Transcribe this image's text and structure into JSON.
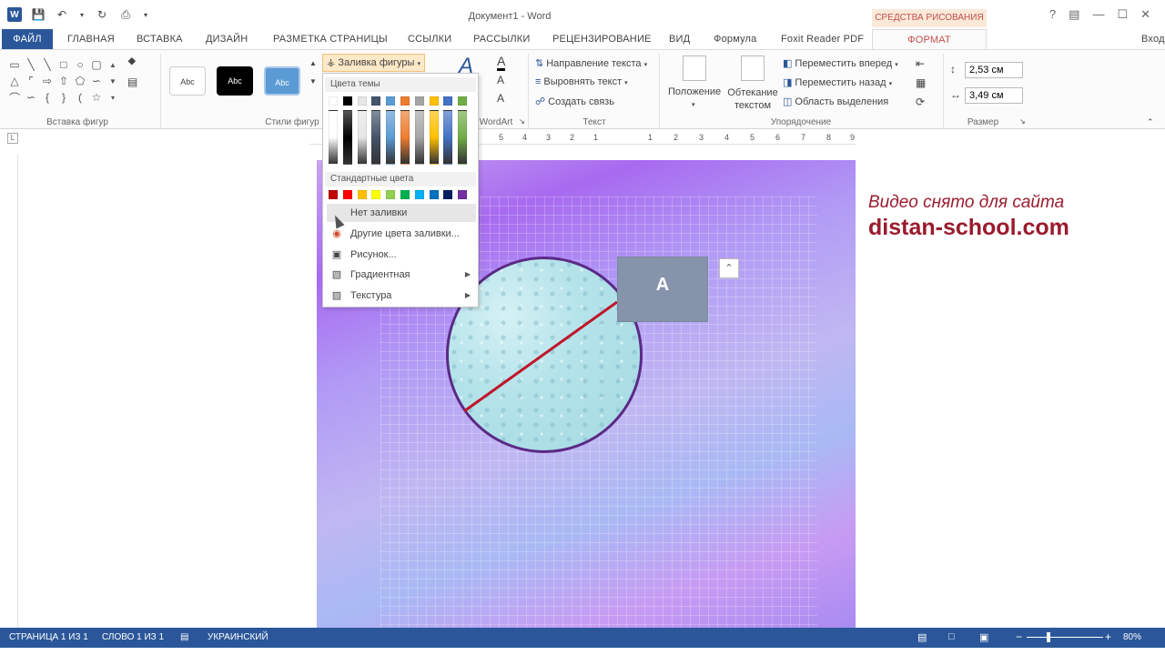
{
  "window": {
    "title": "Документ1 - Word",
    "context_tools": "СРЕДСТВА РИСОВАНИЯ",
    "help": "?",
    "app_logo": "W"
  },
  "qat": [
    "save-icon",
    "undo-icon",
    "redo-icon",
    "print-icon"
  ],
  "tabs": [
    {
      "label": "ФАЙЛ"
    },
    {
      "label": "ГЛАВНАЯ"
    },
    {
      "label": "ВСТАВКА"
    },
    {
      "label": "ДИЗАЙН"
    },
    {
      "label": "РАЗМЕТКА СТРАНИЦЫ"
    },
    {
      "label": "ССЫЛКИ"
    },
    {
      "label": "РАССЫЛКИ"
    },
    {
      "label": "РЕЦЕНЗИРОВАНИЕ"
    },
    {
      "label": "ВИД"
    },
    {
      "label": "Формула"
    },
    {
      "label": "Foxit Reader PDF"
    },
    {
      "label": "ФОРМАТ"
    }
  ],
  "user": "Вход",
  "ribbon": {
    "groups": {
      "insert_shapes": "Вставка фигур",
      "shape_styles": "Стили фигур",
      "wordart": "WordArt",
      "text": "Текст",
      "arrange": "Упорядочение",
      "size": "Размер"
    },
    "style_samples": [
      "Abc",
      "Abc",
      "Abc"
    ],
    "shape_fill": "Заливка фигуры",
    "wordart_glyph": "A",
    "text_direction": "Направление текста",
    "align_text": "Выровнять текст",
    "create_link": "Создать связь",
    "position": "Положение",
    "wrap_text": "Обтекание текстом",
    "bring_forward": "Переместить вперед",
    "send_backward": "Переместить назад",
    "selection_pane": "Область выделения",
    "height": "2,53 см",
    "width": "3,49 см"
  },
  "fill_menu": {
    "theme_colors_label": "Цвета темы",
    "standard_colors_label": "Стандартные цвета",
    "theme_colors": [
      "#ffffff",
      "#000000",
      "#e7e6e6",
      "#44546a",
      "#5b9bd5",
      "#ed7d31",
      "#a5a5a5",
      "#ffc000",
      "#4472c4",
      "#70ad47"
    ],
    "standard_colors": [
      "#c00000",
      "#ff0000",
      "#ffc000",
      "#ffff00",
      "#92d050",
      "#00b050",
      "#00b0f0",
      "#0070c0",
      "#002060",
      "#7030a0"
    ],
    "items": [
      {
        "label": "Нет заливки",
        "icon": "no-fill-icon"
      },
      {
        "label": "Другие цвета заливки...",
        "icon": "palette-icon"
      },
      {
        "label": "Рисунок...",
        "icon": "picture-icon"
      },
      {
        "label": "Градиентная",
        "icon": "gradient-icon"
      },
      {
        "label": "Текстура",
        "icon": "texture-icon"
      }
    ]
  },
  "ruler_numbers": [
    "5",
    "4",
    "3",
    "2",
    "1",
    "1",
    "2",
    "3",
    "4",
    "5",
    "6",
    "7",
    "8",
    "9"
  ],
  "document": {
    "shape_a_text": "A",
    "watermark_line1": "Видео снято для сайта",
    "watermark_line2": "distan-school.com"
  },
  "status": {
    "page": "СТРАНИЦА 1 ИЗ 1",
    "words": "СЛОВО 1 ИЗ 1",
    "language": "УКРАИНСКИЙ",
    "zoom": "80%",
    "zoom_minus": "−",
    "zoom_plus": "+"
  },
  "colors": {
    "accent": "#2b579a",
    "context_tab": "#c0504d",
    "watermark": "#9a1b2e",
    "circle_border": "#5b2a86",
    "diameter_line": "#c0152a",
    "shape_a_fill": "#8593ab"
  }
}
